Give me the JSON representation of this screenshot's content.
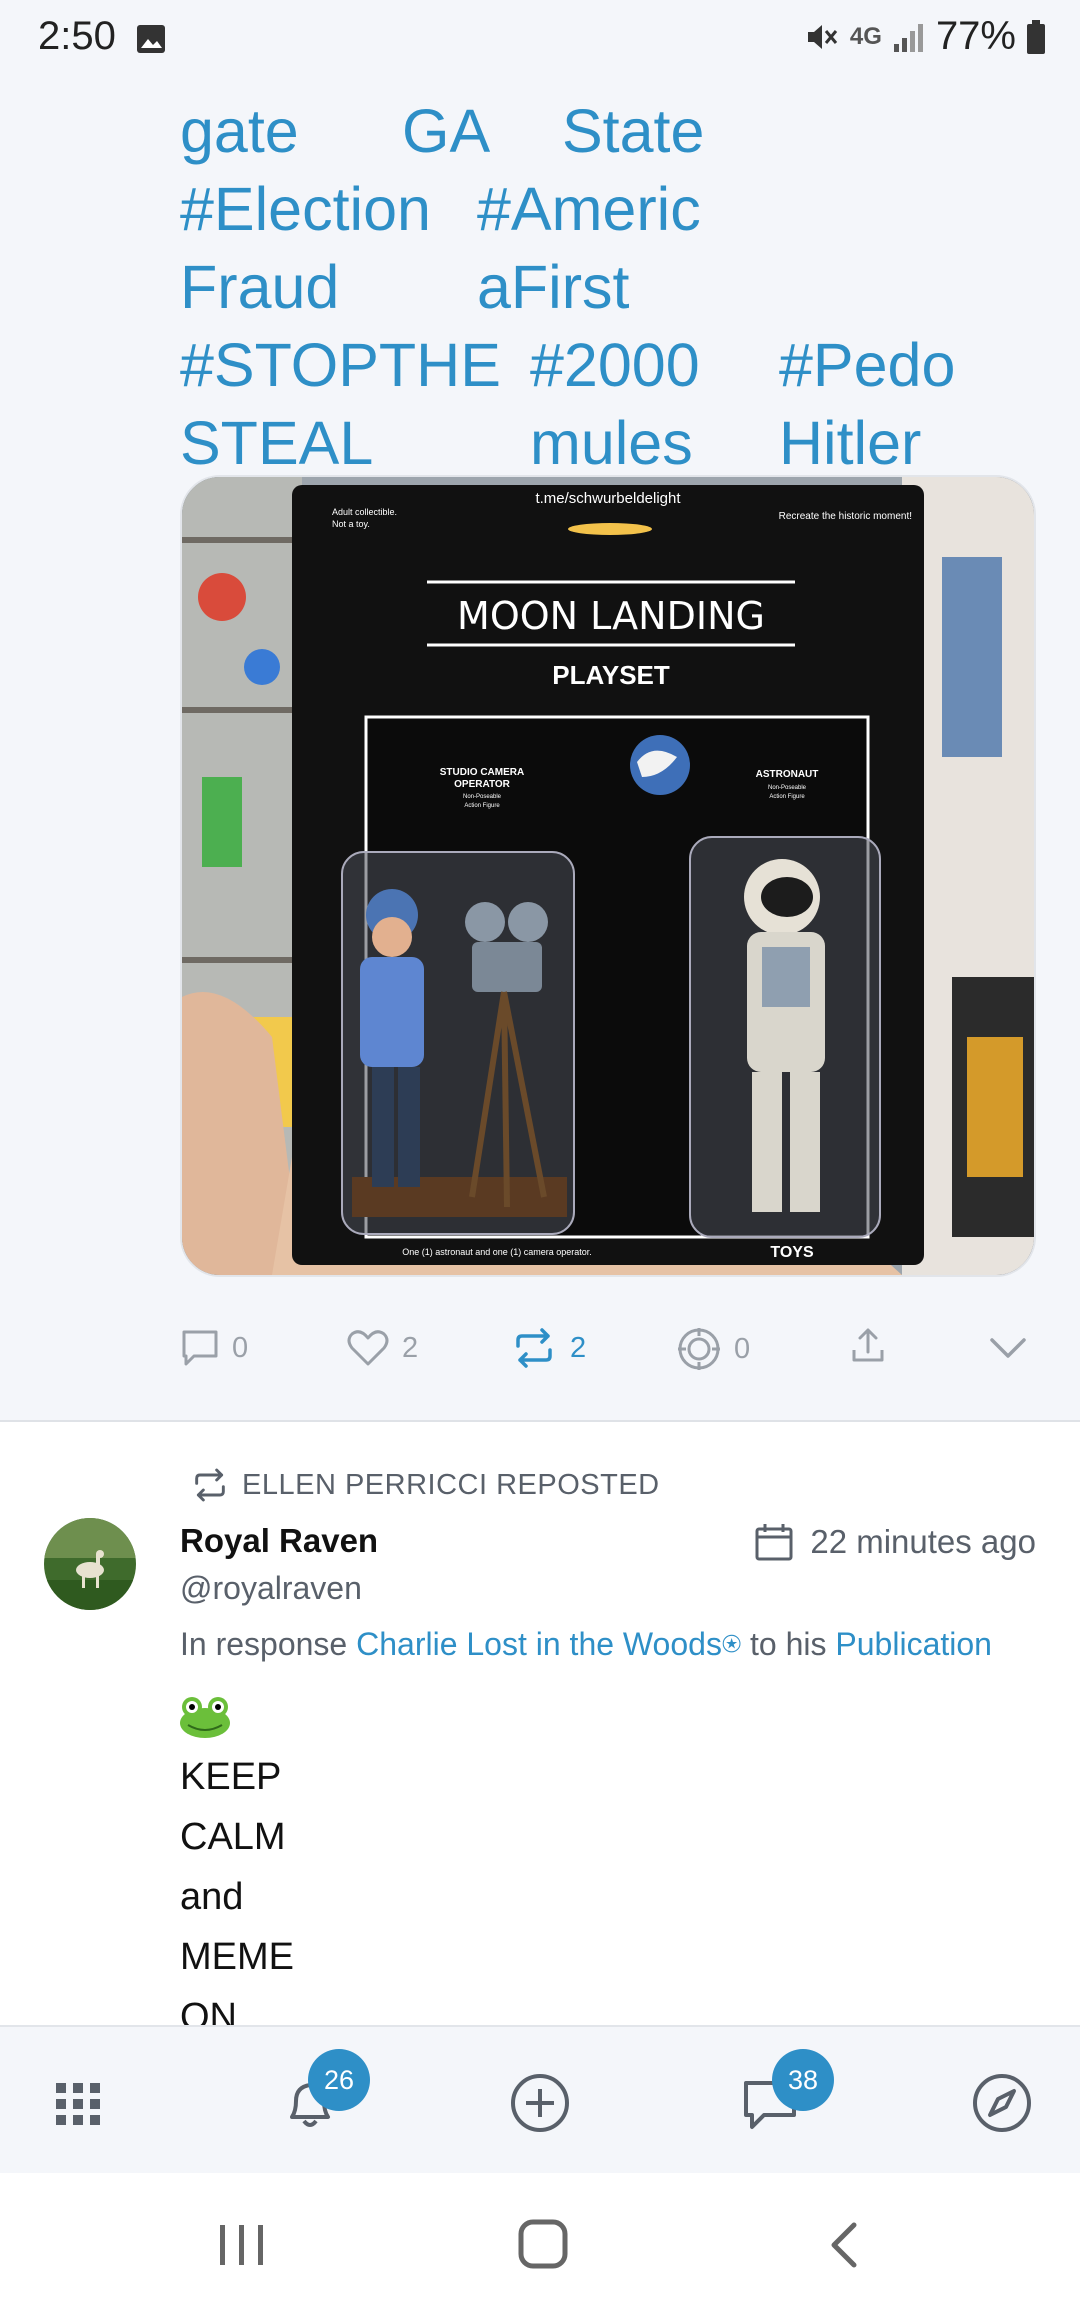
{
  "status_bar": {
    "time": "2:50",
    "network": "4G",
    "battery": "77%",
    "icons": [
      "gallery-icon",
      "mute-icon",
      "network-icon",
      "signal-icon",
      "battery-icon"
    ]
  },
  "post1": {
    "hashtag_lines": [
      [
        "gate",
        "GA",
        "State"
      ],
      [
        "#Election",
        "#Americ"
      ],
      [
        "Fraud",
        "aFirst"
      ],
      [
        "#STOPTHE",
        "#2000",
        "#Pedo"
      ],
      [
        "STEAL",
        "mules",
        "Hitler"
      ]
    ],
    "media": {
      "source_text": "t.me/schwurbeldelight",
      "top_left_text_1": "Adult collectible.",
      "top_left_text_2": "Not a toy.",
      "top_right_text": "Recreate the historic moment!",
      "title": "MOON LANDING",
      "subtitle": "PLAYSET",
      "left_label_1": "STUDIO CAMERA",
      "left_label_2": "OPERATOR",
      "left_label_3": "Non-Poseable",
      "left_label_4": "Action Figure",
      "right_label_1": "ASTRONAUT",
      "right_label_2": "Non-Poseable",
      "right_label_3": "Action Figure",
      "footer_text": "One (1) astronaut and one (1) camera operator.",
      "brand": "TOYS"
    },
    "actions": {
      "reply_count": "0",
      "like_count": "2",
      "repost_count": "2",
      "quote_count": "0"
    }
  },
  "post2": {
    "repost_label": "ELLEN PERRICCI REPOSTED",
    "author_name": "Royal Raven",
    "author_handle": "@royalraven",
    "timestamp": "22 minutes ago",
    "response_prefix": "In response ",
    "response_user": "Charlie Lost in the Woods⍟",
    "response_mid": " to his ",
    "response_link": "Publication",
    "body_lines": [
      "KEEP",
      "CALM",
      "and",
      "MEME",
      "ON"
    ]
  },
  "bottom_nav": {
    "notifications_badge": "26",
    "messages_badge": "38"
  },
  "colors": {
    "accent": "#2e8fc7",
    "muted": "#9aa0a8",
    "background": "#f4f6fa"
  }
}
